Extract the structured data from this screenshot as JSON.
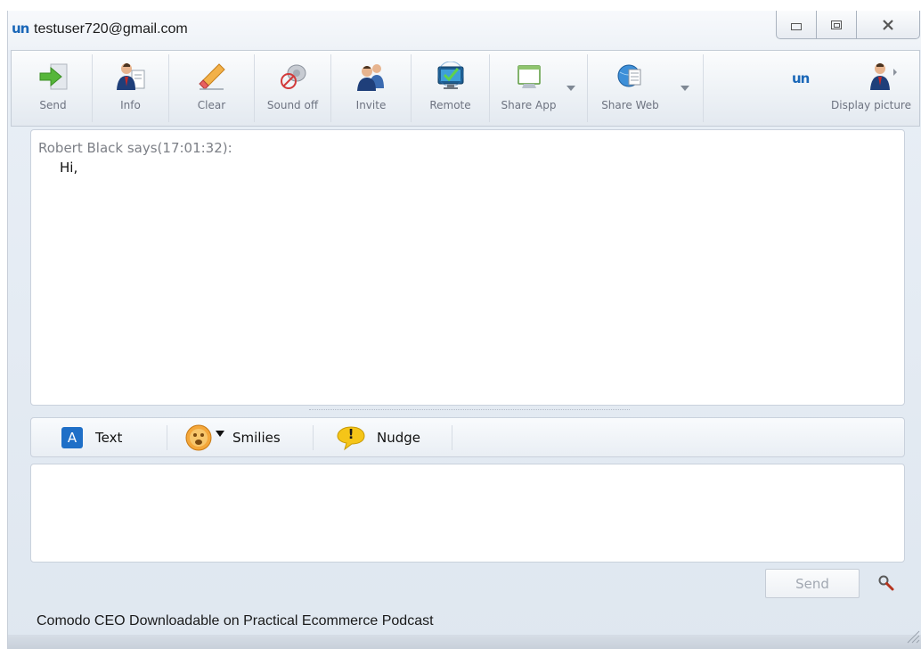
{
  "window": {
    "title": "testuser720@gmail.com",
    "logo_text": "un"
  },
  "toolbar": {
    "buttons": [
      {
        "label": "Send",
        "icon": "send-arrow-icon"
      },
      {
        "label": "Info",
        "icon": "contact-info-icon"
      },
      {
        "label": "Clear",
        "icon": "eraser-icon"
      },
      {
        "label": "Sound off",
        "icon": "speaker-mute-icon"
      },
      {
        "label": "Invite",
        "icon": "invite-users-icon"
      },
      {
        "label": "Remote",
        "icon": "remote-desktop-icon"
      },
      {
        "label": "Share App",
        "icon": "share-app-icon"
      },
      {
        "label": "Share Web",
        "icon": "share-web-icon"
      }
    ],
    "brand_logo_text": "un",
    "display_picture_label": "Display picture"
  },
  "chat": {
    "messages": [
      {
        "header": "Robert Black says(17:01:32):",
        "body": "Hi,"
      }
    ]
  },
  "format_bar": {
    "text_badge": "A",
    "text_label": "Text",
    "smilies_label": "Smilies",
    "nudge_label": "Nudge",
    "nudge_glyph": "!"
  },
  "compose": {
    "send_label": "Send"
  },
  "ticker": {
    "text": "Comodo CEO Downloadable on Practical Ecommerce Podcast"
  },
  "colors": {
    "brand_blue": "#1a67b8",
    "window_bg": "#e5ebf2",
    "muted_text": "#7c7f86"
  }
}
